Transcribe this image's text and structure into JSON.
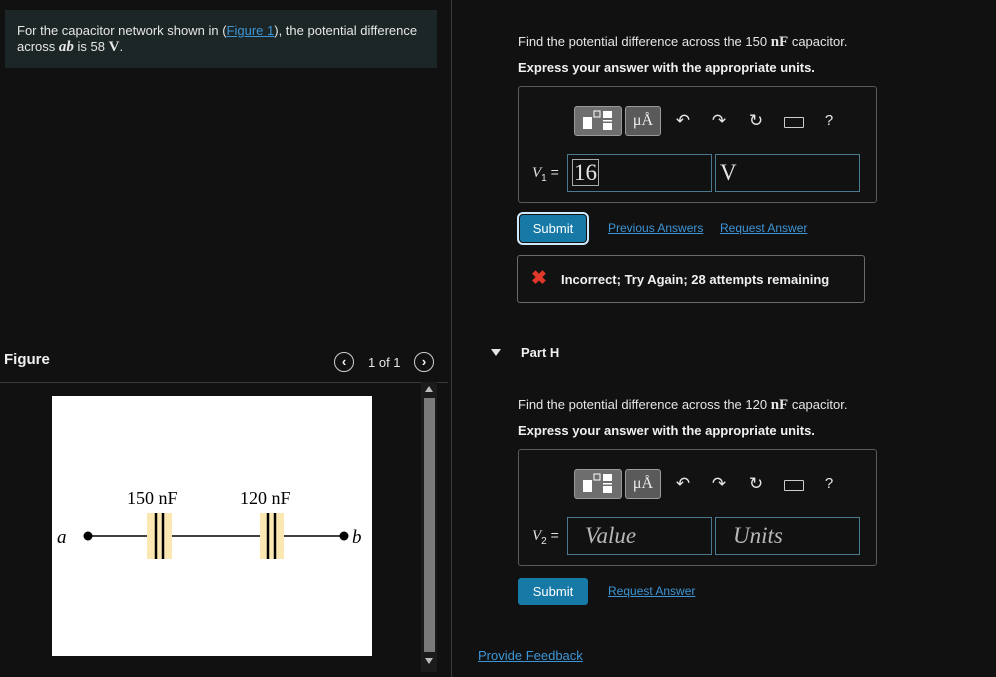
{
  "problem": {
    "text_before": "For the capacitor network shown in (",
    "figure_link": "Figure 1",
    "text_middle": "), the potential difference across ",
    "var": "ab",
    "text_is": " is 58 ",
    "unit": "V",
    "text_end": "."
  },
  "figure_panel": {
    "title": "Figure",
    "page_indicator": "1 of 1",
    "prev_icon": "chevron-left-icon",
    "next_icon": "chevron-right-icon",
    "cap1_label": "150 nF",
    "cap2_label": "120 nF",
    "node_a": "a",
    "node_b": "b"
  },
  "part_g": {
    "question_prefix": "Find the potential difference across the 150 ",
    "question_unit": "nF",
    "question_suffix": " capacitor.",
    "instruction": "Express your answer with the appropriate units.",
    "var_label": "V",
    "var_sub": "1",
    "equals": "=",
    "value": "16",
    "units_value": "V",
    "submit_label": "Submit",
    "previous_answers_label": "Previous Answers",
    "request_answer_label": "Request Answer",
    "feedback_icon": "x-icon",
    "feedback_text": "Incorrect; Try Again; 28 attempts remaining"
  },
  "toolbar": {
    "template_icon": "template-icon",
    "units_symbol": "μÅ",
    "undo_icon": "undo-icon",
    "redo_icon": "redo-icon",
    "reset_icon": "reset-icon",
    "keyboard_icon": "keyboard-icon",
    "help_label": "?"
  },
  "part_h": {
    "header": "Part H",
    "question_prefix": "Find the potential difference across the 120 ",
    "question_unit": "nF",
    "question_suffix": " capacitor.",
    "instruction": "Express your answer with the appropriate units.",
    "var_label": "V",
    "var_sub": "2",
    "equals": "=",
    "value_placeholder": "Value",
    "units_placeholder": "Units",
    "submit_label": "Submit",
    "request_answer_label": "Request Answer"
  },
  "footer": {
    "provide_feedback_label": "Provide Feedback"
  },
  "colors": {
    "background": "#111111",
    "accent_blue": "#1779a6",
    "link_blue": "#3d95d6",
    "error_red": "#e0392b"
  }
}
